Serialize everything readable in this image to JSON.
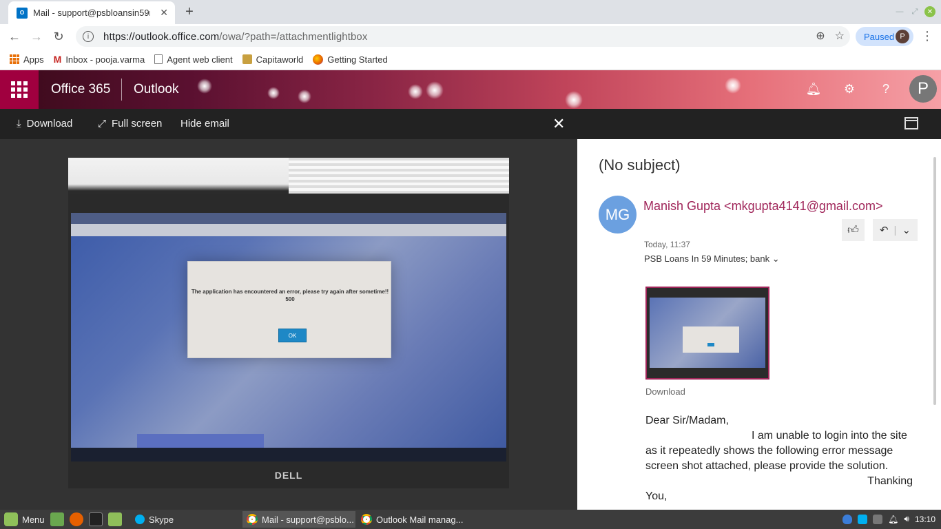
{
  "browser": {
    "tab_title": "Mail - support@psbloansin59m",
    "tab_favicon": "O",
    "url_host": "https://outlook.office.com",
    "url_path": "/owa/?path=/attachmentlightbox",
    "paused_label": "Paused",
    "profile_initial": "P"
  },
  "bookmarks": [
    {
      "label": "Apps"
    },
    {
      "label": "Inbox - pooja.varma"
    },
    {
      "label": "Agent web client"
    },
    {
      "label": "Capitaworld"
    },
    {
      "label": "Getting Started"
    }
  ],
  "o365": {
    "suite_title": "Office 365",
    "app_name": "Outlook",
    "avatar_initial": "P"
  },
  "viewer": {
    "download_label": "Download",
    "fullscreen_label": "Full screen",
    "hide_email_label": "Hide email"
  },
  "photo": {
    "dialog_message": "The application has encountered an error, please try again after sometime!! 500",
    "ok_label": "OK",
    "brand": "DELL"
  },
  "email": {
    "subject": "(No subject)",
    "sender_initials": "MG",
    "sender": "Manish Gupta <mkgupta4141@gmail.com>",
    "date": "Today, 11:37",
    "categories": "PSB Loans In 59 Minutes; bank",
    "attachment_caption": "Download",
    "body_lines": [
      "Dear Sir/Madam,",
      "I am unable to login into the site as it repeatedly shows the following error message screen shot attached, please provide the solution.",
      "Thanking",
      "You,"
    ]
  },
  "taskbar": {
    "menu_label": "Menu",
    "windows": [
      {
        "label": "Skype"
      },
      {
        "label": "Mail - support@psblo..."
      },
      {
        "label": "Outlook Mail manag..."
      }
    ],
    "clock": "13:10"
  },
  "colors": {
    "brand_accent": "#a0265a",
    "waffle_bg": "#a0003f",
    "viewer_bg": "#222222"
  }
}
